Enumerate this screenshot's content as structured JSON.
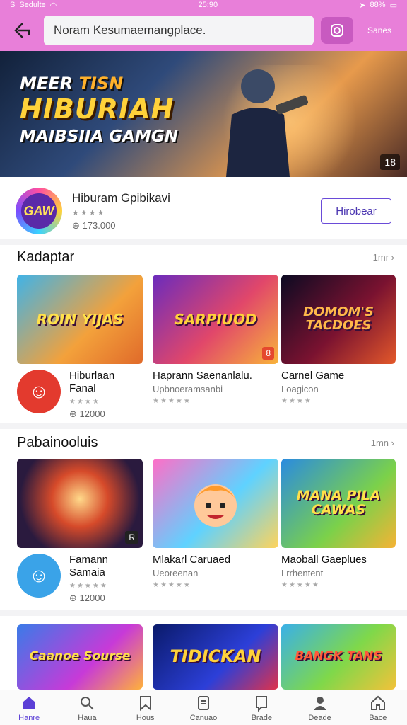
{
  "status_bar": {
    "left": "S",
    "carrier": "Sedulte",
    "time": "25:90",
    "battery": "88%"
  },
  "search": {
    "value": "Noram Kesumaemangplace."
  },
  "top_bar": {
    "lang_label": "Sanes"
  },
  "banner": {
    "line1_a": "MEER",
    "line1_b": "TISN",
    "line2": "HIBURIAH",
    "line3": "MAIBSIIA GAMGN",
    "badge": "18"
  },
  "featured_app": {
    "logo_text": "GAW",
    "name": "Hiburam Gpibikavi",
    "stars": "★★★★",
    "count": "173.000",
    "action": "Hirobear"
  },
  "sections": [
    {
      "title": "Kadaptar",
      "more": "1mr",
      "cards": [
        {
          "thumb_title": "ROIN YIJAS",
          "name": "Hiburlaan Fanal",
          "sub": "",
          "stars": "★★★★",
          "count": "12000",
          "corner": ""
        },
        {
          "thumb_title": "SARPIUOD",
          "name": "Haprann Saenanlalu.",
          "sub": "Upbnoeramsanbi",
          "stars": "★★★★★",
          "count": "",
          "corner": "8"
        },
        {
          "thumb_title": "DOMOM'S TACDOES",
          "name": "Carnel Game",
          "sub": "Loagicon",
          "stars": "★★★★",
          "count": "",
          "corner": ""
        }
      ]
    },
    {
      "title": "Pabainooluis",
      "more": "1mn",
      "cards": [
        {
          "thumb_title": "",
          "name": "Famann Samaia",
          "sub": "",
          "stars": "★★★★★",
          "count": "12000",
          "corner": "R"
        },
        {
          "thumb_title": "",
          "name": "Mlakarl Caruaed",
          "sub": "Ueoreenan",
          "stars": "★★★★★",
          "count": "",
          "corner": ""
        },
        {
          "thumb_title": "MANA PILA CAWAS",
          "name": "Maoball Gaeplues",
          "sub": "Lrrhentent",
          "stars": "★★★★★",
          "count": "",
          "corner": ""
        }
      ]
    }
  ],
  "row3": [
    {
      "thumb_title": "Caanoe Sourse"
    },
    {
      "thumb_title": "TIDICKAN"
    },
    {
      "thumb_title": "BANGK TANS"
    }
  ],
  "bottom_nav": [
    {
      "label": "Hanre",
      "icon": "home-icon"
    },
    {
      "label": "Haua",
      "icon": "search-icon"
    },
    {
      "label": "Hous",
      "icon": "bookmark-icon"
    },
    {
      "label": "Canuao",
      "icon": "device-icon"
    },
    {
      "label": "Brade",
      "icon": "flag-icon"
    },
    {
      "label": "Deade",
      "icon": "user-icon"
    },
    {
      "label": "Bace",
      "icon": "house-outline-icon"
    }
  ],
  "colors": {
    "top_bar": "#e87fd9",
    "accent": "#5b3fd6"
  }
}
